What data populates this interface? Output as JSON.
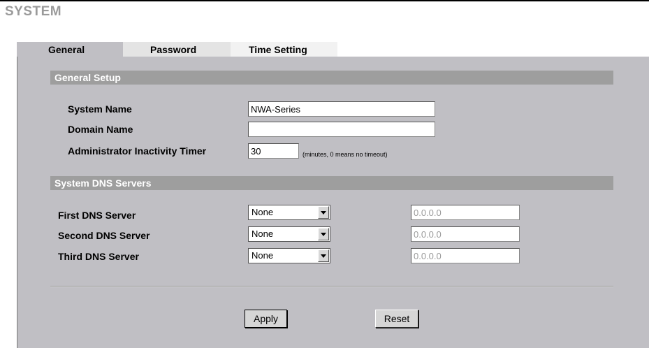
{
  "page": {
    "title": "SYSTEM"
  },
  "tabs": [
    {
      "label": "General",
      "active": true
    },
    {
      "label": "Password",
      "active": false
    },
    {
      "label": "Time Setting",
      "active": false
    }
  ],
  "general_setup": {
    "header": "General Setup",
    "system_name": {
      "label": "System Name",
      "value": "NWA-Series"
    },
    "domain_name": {
      "label": "Domain Name",
      "value": ""
    },
    "inactivity_timer": {
      "label": "Administrator Inactivity Timer",
      "value": "30",
      "hint": "(minutes, 0 means no timeout)"
    }
  },
  "dns": {
    "header": "System DNS Servers",
    "servers": [
      {
        "label": "First DNS Server",
        "selected": "None",
        "ip": "0.0.0.0"
      },
      {
        "label": "Second DNS Server",
        "selected": "None",
        "ip": "0.0.0.0"
      },
      {
        "label": "Third DNS Server",
        "selected": "None",
        "ip": "0.0.0.0"
      }
    ]
  },
  "buttons": {
    "apply": "Apply",
    "reset": "Reset"
  },
  "colors": {
    "panel": "#c0bfc4",
    "section_header": "#9e9e9e",
    "title": "#9a9a9a"
  }
}
